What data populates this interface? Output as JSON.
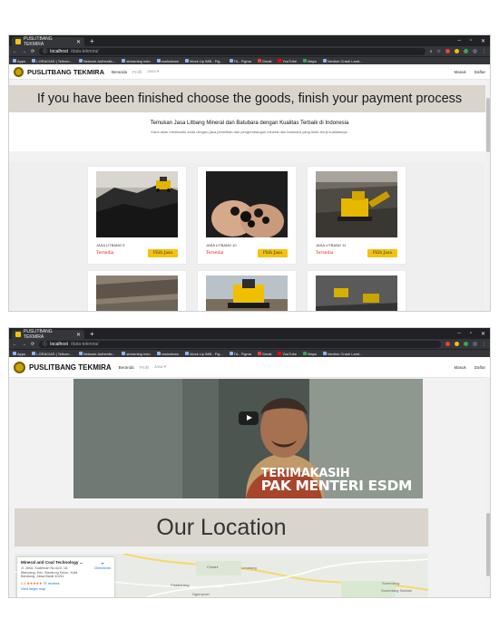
{
  "browser": {
    "tab_title": "PUSLITBANG TEKMIRA",
    "url_host": "localhost",
    "url_path": "/data-tekmira/",
    "bookmarks": [
      "Apps",
      "I-GRACIAS | Telkom...",
      "Network Authentic...",
      "streaming indo",
      "xsalonbaru",
      "Mock Up IMB - Fig...",
      "TA - Figma",
      "Gmail",
      "YouTube",
      "Maps",
      "Nextion Crash Land..."
    ]
  },
  "nav": {
    "brand": "PUSLITBANG TEKMIRA",
    "links": [
      "Beranda",
      "Profil",
      "Jasa ▾"
    ],
    "masuk": "Masuk",
    "daftar": "Daftar"
  },
  "page1": {
    "banner": "If you have been finished choose the goods, finish your payment process",
    "intro_title": "Temukan Jasa Litbang Mineral dan Batubara dengan Kualitas Terbaik di Indonesia",
    "intro_sub": "Kami akan membantu anda dengan jasa penelitian dan pengembangan mineral dan batubara yang telah teruji kualitasnya.",
    "cards": [
      {
        "name": "JASA LITBANG 9",
        "status": "Tersedia",
        "button": "Pilih Jasa"
      },
      {
        "name": "JASA LITBANG 10",
        "status": "Tersedia",
        "button": "Pilih Jasa"
      },
      {
        "name": "JASA LITBANG 11",
        "status": "Tersedia",
        "button": "Pilih Jasa"
      }
    ]
  },
  "page2": {
    "video_caption_1": "TERIMAKASIH",
    "video_caption_2": "PAK MENTERI ESDM",
    "location_title": "Our Location",
    "map": {
      "title": "Mineral and Coal Technology ...",
      "address": "Jl. Jend. Sudirman No.623, 18, Mancang, Kec. Bandung Kulon, Kota Bandung, Jawa Barat 40211",
      "directions": "Directions",
      "rating": "4.4 ★★★★★",
      "reviews": "75 reviews",
      "larger_map": "View larger map",
      "places": [
        "Cimahi",
        "Lembang",
        "Padalarang",
        "Ngamprah",
        "Sumedang",
        "Sumedang Selatan"
      ]
    }
  },
  "colors": {
    "accent_button": "#f4c20d",
    "status_red": "#d21111",
    "banner_bg": "#d9d4cc",
    "chrome_dark": "#202124"
  }
}
